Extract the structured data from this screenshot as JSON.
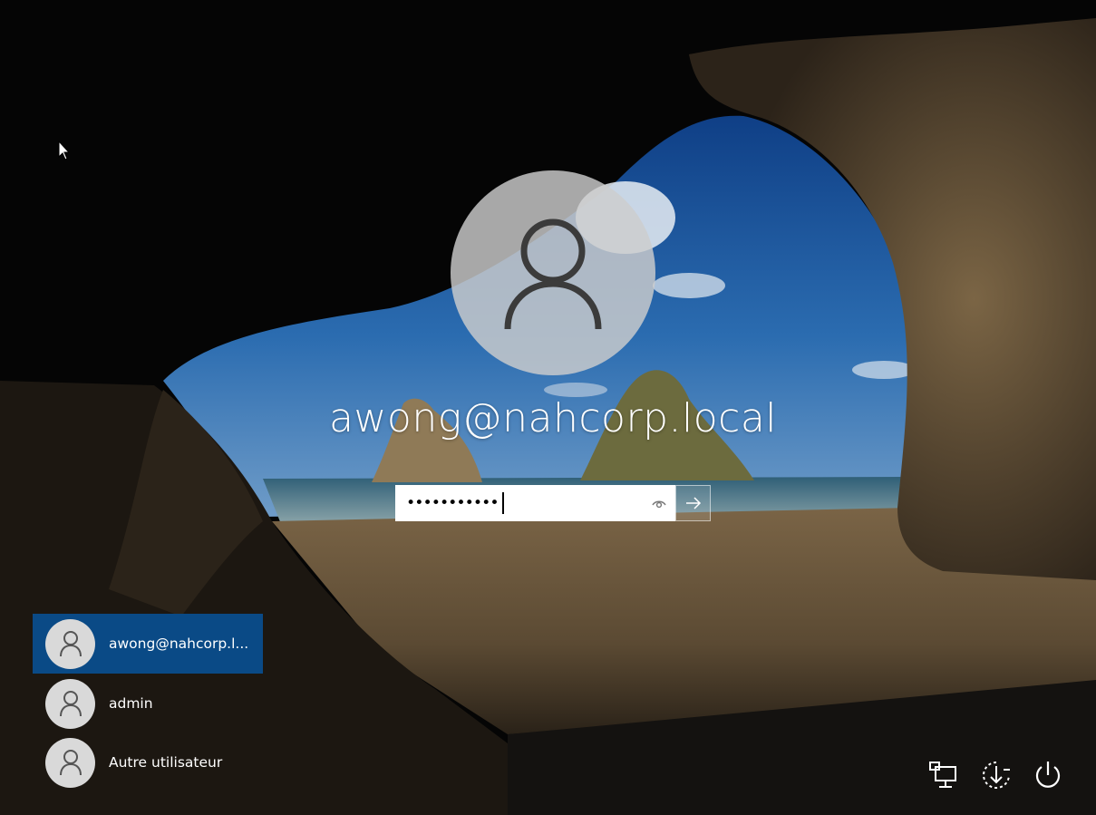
{
  "login": {
    "display_name": "awong@nahcorp.local",
    "password_masked": "•••••••••••",
    "icons": {
      "avatar": "user-silhouette-icon",
      "reveal": "eye-icon",
      "submit": "arrow-right-icon"
    }
  },
  "users": [
    {
      "label": "awong@nahcorp.l...",
      "selected": true
    },
    {
      "label": "admin",
      "selected": false
    },
    {
      "label": "Autre utilisateur",
      "selected": false
    }
  ],
  "system_icons": [
    "network-icon",
    "ease-of-access-icon",
    "power-icon"
  ],
  "colors": {
    "selected_user_bg": "#0a4a86",
    "avatar_bg": "#cdcdcd",
    "text": "#ffffff"
  }
}
